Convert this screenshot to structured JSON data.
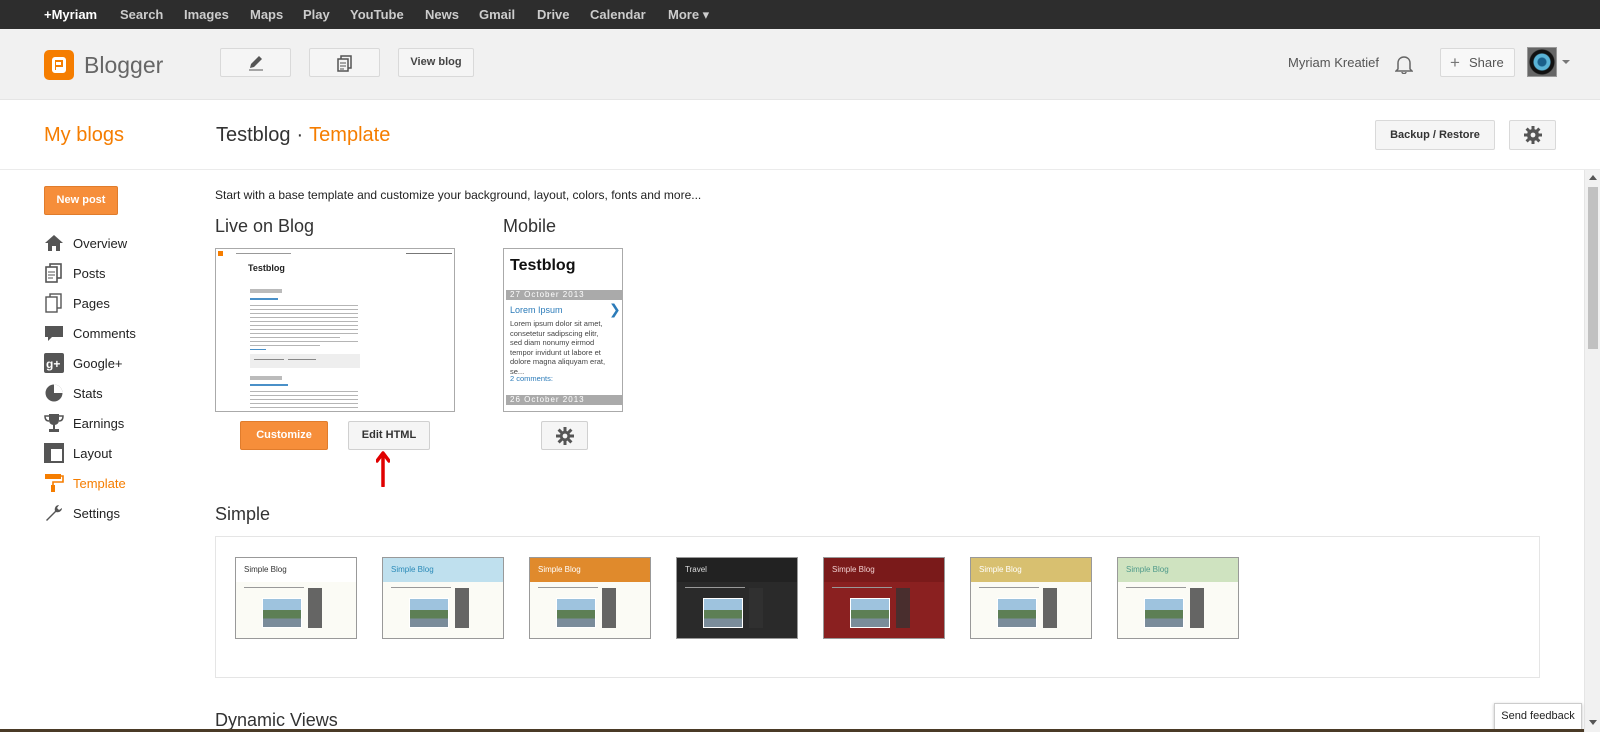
{
  "gbar": {
    "links": [
      "+Myriam",
      "Search",
      "Images",
      "Maps",
      "Play",
      "YouTube",
      "News",
      "Gmail",
      "Drive",
      "Calendar",
      "More ▾"
    ]
  },
  "header": {
    "brand": "Blogger",
    "view_blog": "View blog",
    "username": "Myriam Kreatief",
    "share": "Share",
    "icons": [
      "pencil-icon",
      "posts-icon",
      "bell-icon",
      "avatar"
    ]
  },
  "title_row": {
    "my_blogs": "My blogs",
    "blog_name": "Testblog",
    "separator": "·",
    "current_page": "Template",
    "backup_restore": "Backup / Restore"
  },
  "sidebar": {
    "new_post": "New post",
    "items": [
      {
        "label": "Overview",
        "icon": "home-icon"
      },
      {
        "label": "Posts",
        "icon": "posts-icon"
      },
      {
        "label": "Pages",
        "icon": "pages-icon"
      },
      {
        "label": "Comments",
        "icon": "comments-icon"
      },
      {
        "label": "Google+",
        "icon": "googleplus-icon"
      },
      {
        "label": "Stats",
        "icon": "pie-chart-icon"
      },
      {
        "label": "Earnings",
        "icon": "trophy-icon"
      },
      {
        "label": "Layout",
        "icon": "layout-icon"
      },
      {
        "label": "Template",
        "icon": "paint-roller-icon",
        "active": true
      },
      {
        "label": "Settings",
        "icon": "wrench-icon"
      }
    ]
  },
  "main": {
    "intro": "Start with a base template and customize your background, layout, colors, fonts and more...",
    "live_heading": "Live on Blog",
    "mobile_heading": "Mobile",
    "live_preview_title": "Testblog",
    "customize": "Customize",
    "edit_html": "Edit HTML",
    "mobile_preview": {
      "title": "Testblog",
      "date1": "27 October 2013",
      "post_title": "Lorem Ipsum",
      "body": "Lorem ipsum dolor sit amet, consetetur sadipscing elitr, sed diam nonumy eirmod tempor invidunt ut labore et dolore magna aliquyam erat, se...",
      "comments": "2 comments:",
      "date2": "26 October 2013"
    },
    "simple_heading": "Simple",
    "simple_templates": [
      {
        "name": "Simple Blog",
        "header_color": "#ffffff",
        "text_color": "#333333"
      },
      {
        "name": "Simple Blog",
        "header_color": "#bfe0ee",
        "text_color": "#2a8ab8"
      },
      {
        "name": "Simple Blog",
        "header_color": "#e08a2c",
        "text_color": "#ffffff"
      },
      {
        "name": "Travel",
        "header_color": "#222222",
        "text_color": "#dddddd"
      },
      {
        "name": "Simple Blog",
        "header_color": "#7a1a1a",
        "text_color": "#f0d0d0"
      },
      {
        "name": "Simple Blog",
        "header_color": "#d8c070",
        "text_color": "#ffffff"
      },
      {
        "name": "Simple Blog",
        "header_color": "#cfe3c0",
        "text_color": "#4f9a8a"
      }
    ],
    "dynamic_heading": "Dynamic Views"
  },
  "feedback": "Send feedback",
  "colors": {
    "accent": "#f57d00",
    "button_orange": "#f68e3a",
    "gbar": "#2d2d2d",
    "annotation_arrow": "#e00000"
  }
}
